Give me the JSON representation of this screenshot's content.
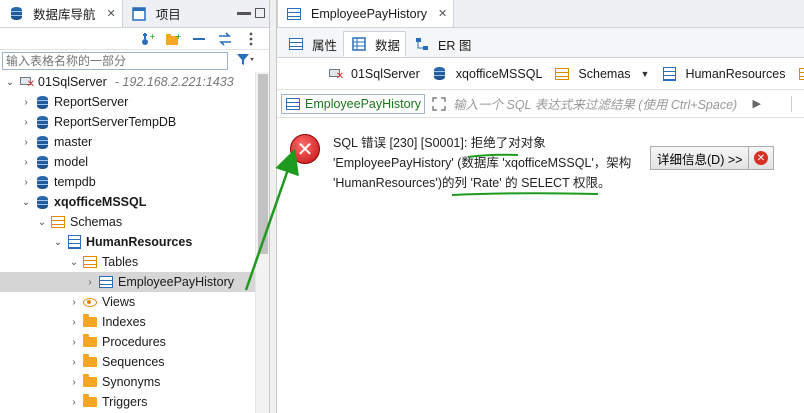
{
  "left_panel": {
    "tabs": [
      {
        "label": "数据库导航",
        "close": "✕"
      },
      {
        "label": "项目"
      }
    ],
    "filter": {
      "placeholder": "输入表格名称的一部分"
    },
    "tree": [
      {
        "label": "01SqlServer",
        "host": "- 192.168.2.221:1433",
        "icon": "server-error-icon",
        "arrow": "⌄"
      },
      {
        "label": "ReportServer",
        "icon": "database-icon",
        "arrow": "›"
      },
      {
        "label": "ReportServerTempDB",
        "icon": "database-icon",
        "arrow": "›"
      },
      {
        "label": "master",
        "icon": "database-icon",
        "arrow": "›"
      },
      {
        "label": "model",
        "icon": "database-icon",
        "arrow": "›"
      },
      {
        "label": "tempdb",
        "icon": "database-icon",
        "arrow": "›"
      },
      {
        "label": "xqofficeMSSQL",
        "icon": "database-icon",
        "arrow": "⌄",
        "bold": true
      },
      {
        "label": "Schemas",
        "icon": "folder-icon",
        "arrow": "⌄"
      },
      {
        "label": "HumanResources",
        "icon": "schema-icon",
        "arrow": "⌄",
        "bold": true
      },
      {
        "label": "Tables",
        "icon": "folder-icon",
        "arrow": "⌄"
      },
      {
        "label": "EmployeePayHistory",
        "icon": "table-icon",
        "arrow": "›",
        "selected": true
      },
      {
        "label": "Views",
        "icon": "view-icon",
        "arrow": "›"
      },
      {
        "label": "Indexes",
        "icon": "folder-icon",
        "arrow": "›"
      },
      {
        "label": "Procedures",
        "icon": "folder-icon",
        "arrow": "›"
      },
      {
        "label": "Sequences",
        "icon": "folder-icon",
        "arrow": "›"
      },
      {
        "label": "Synonyms",
        "icon": "folder-icon",
        "arrow": "›"
      },
      {
        "label": "Triggers",
        "icon": "folder-icon",
        "arrow": "›"
      }
    ]
  },
  "editor": {
    "tab": {
      "label": "EmployeePayHistory",
      "close": "✕"
    },
    "subtabs": [
      {
        "label": "属性"
      },
      {
        "label": "数据"
      },
      {
        "label": "ER 图"
      }
    ],
    "breadcrumb": [
      {
        "label": "01SqlServer"
      },
      {
        "label": "xqofficeMSSQL"
      },
      {
        "label": "Schemas",
        "dropdown": "▼"
      },
      {
        "label": "HumanResources"
      }
    ],
    "sql_filter": {
      "object": "EmployeePayHistory",
      "placeholder": "输入一个 SQL 表达式来过滤结果 (使用 Ctrl+Space)"
    },
    "error": {
      "lines": [
        "SQL 错误 [230] [S0001]: 拒绝了对对象",
        "'EmployeePayHistory' (数据库 'xqofficeMSSQL'，架构",
        "'HumanResources')的列 'Rate' 的 SELECT 权限。"
      ],
      "detail_button": "详细信息(D) >>",
      "icon": "error-icon"
    }
  },
  "colors": {
    "annotation_green": "#1e9a1e",
    "accent_blue": "#2a6ebb",
    "folder_orange": "#f5a623"
  }
}
